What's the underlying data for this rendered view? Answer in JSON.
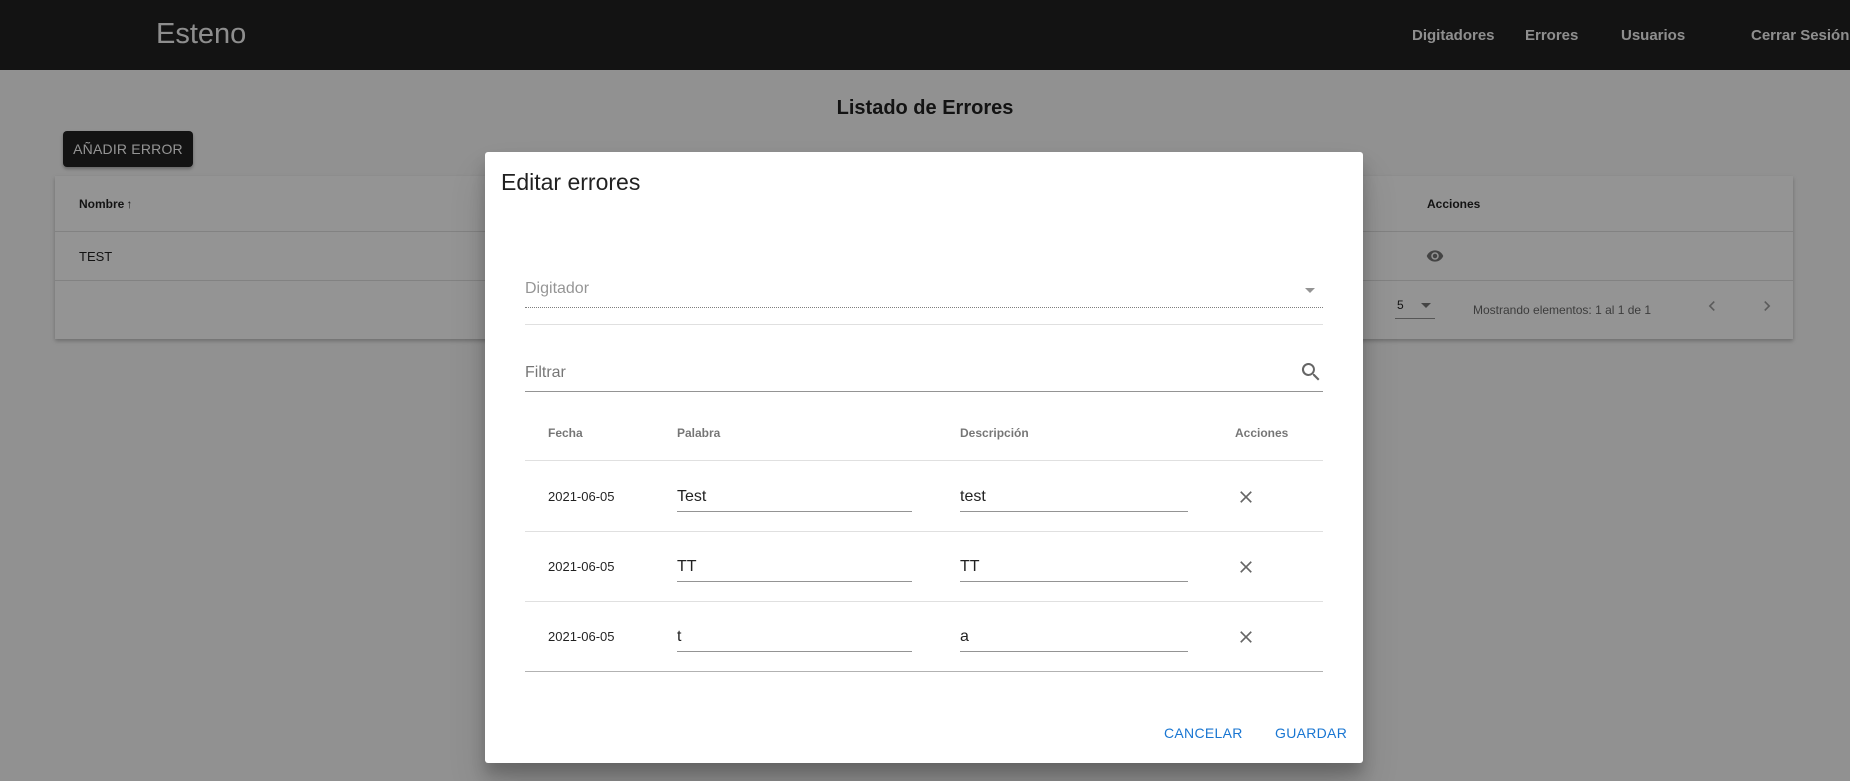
{
  "header": {
    "brand": "Esteno",
    "nav": [
      {
        "label": "Digitadores"
      },
      {
        "label": "Errores"
      },
      {
        "label": "Usuarios"
      },
      {
        "label": "Cerrar Sesión"
      }
    ]
  },
  "page": {
    "title": "Listado de Errores",
    "add_button": "AÑADIR ERROR",
    "table": {
      "columns": [
        "Nombre",
        "Acciones"
      ],
      "sort_arrow": "↑",
      "rows": [
        {
          "name": "TEST"
        }
      ],
      "page_size": "5",
      "range_label": "Mostrando elementos: 1 al 1 de 1"
    }
  },
  "dialog": {
    "title": "Editar errores",
    "select_label": "Digitador",
    "filter_placeholder": "Filtrar",
    "table": {
      "columns": [
        "Fecha",
        "Palabra",
        "Descripción",
        "Acciones"
      ],
      "rows": [
        {
          "fecha": "2021-06-05",
          "palabra": "Test",
          "descripcion": "test"
        },
        {
          "fecha": "2021-06-05",
          "palabra": "TT",
          "descripcion": "TT"
        },
        {
          "fecha": "2021-06-05",
          "palabra": "t",
          "descripcion": "a"
        }
      ]
    },
    "cancel_label": "CANCELAR",
    "save_label": "GUARDAR"
  },
  "colors": {
    "header_bg": "#212121",
    "accent": "#1976d2",
    "overlay": "rgba(0,0,0,0.42)"
  },
  "icons": [
    "sort-arrow-icon",
    "eye-icon",
    "chevron-down-icon",
    "chevron-left-icon",
    "chevron-right-icon",
    "search-icon",
    "close-icon"
  ]
}
